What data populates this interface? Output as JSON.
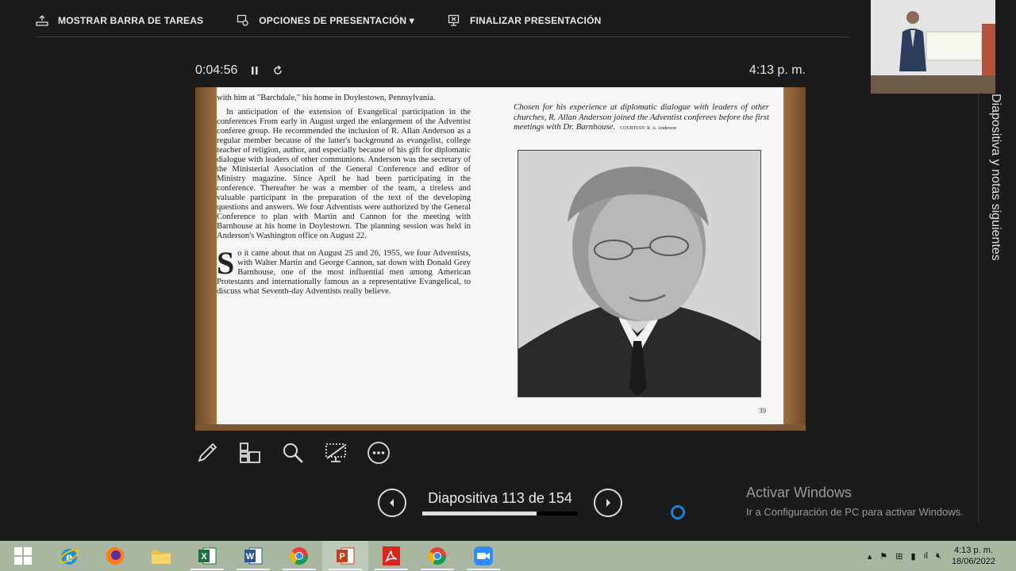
{
  "toolbar": {
    "show_taskbar": "MOSTRAR BARRA DE TAREAS",
    "presentation_options": "OPCIONES DE PRESENTACIÓN ▾",
    "end_presentation": "FINALIZAR PRESENTACIÓN"
  },
  "presenter": {
    "elapsed": "0:04:56",
    "clock": "4:13 p. m.",
    "next_slide_label": "Diapositiva y notas siguientes"
  },
  "navigation": {
    "label": "Diapositiva 113 de 154",
    "current": 113,
    "total": 154,
    "progress_fraction": 0.733
  },
  "slide": {
    "paragraph_1": "with him at \"Barchdale,\" his home in Doylestown, Pennsylvania.",
    "paragraph_2": "In anticipation of the extension of Evangelical participation in the conferences From early in August urged the enlargement of the Adventist conferee group. He recommended the inclusion of R. Allan Anderson as a regular member because of the latter's background as evangelist, college teacher of religion, author, and especially because of his gift for diplomatic dialogue with leaders of other communions. Anderson was the secretary of the Ministerial Association of the General Conference and editor of Ministry magazine. Since April he had been participating in the conference. Thereafter he was a member of the team, a tireless and valuable participant in the preparation of the text of the developing questions and answers. We four Adventists were authorized by the General Conference to plan with Martin and Cannon for the meeting with Barnhouse at his home in Doylestown. The planning session was held in Anderson's Washington office on August 22.",
    "drop_cap": "S",
    "paragraph_3": "o it came about that on August 25 and 26, 1955, we four Adventists, with Walter Martin and George Cannon, sat down with Donald Grey Barnhouse, one of the most influential men among American Protestants and internationally famous as a representative Evangelical, to discuss what Seventh-day Adventists really believe.",
    "caption": "Chosen for his experience at diplomatic dialogue with leaders of other churches, R. Allan Anderson joined the Adventist conferees before the first meetings with Dr. Barnhouse.",
    "credit": "COURTESY: R. A. Anderson",
    "page_number": "39"
  },
  "watermark": {
    "title": "Activar Windows",
    "subtitle": "Ir a Configuración de PC para activar Windows."
  },
  "tray": {
    "time": "4:13 p. m.",
    "date": "18/06/2022"
  },
  "colors": {
    "background": "#1b1b1b",
    "taskbar": "#aab7a0",
    "spinner": "#1e7fd6"
  }
}
